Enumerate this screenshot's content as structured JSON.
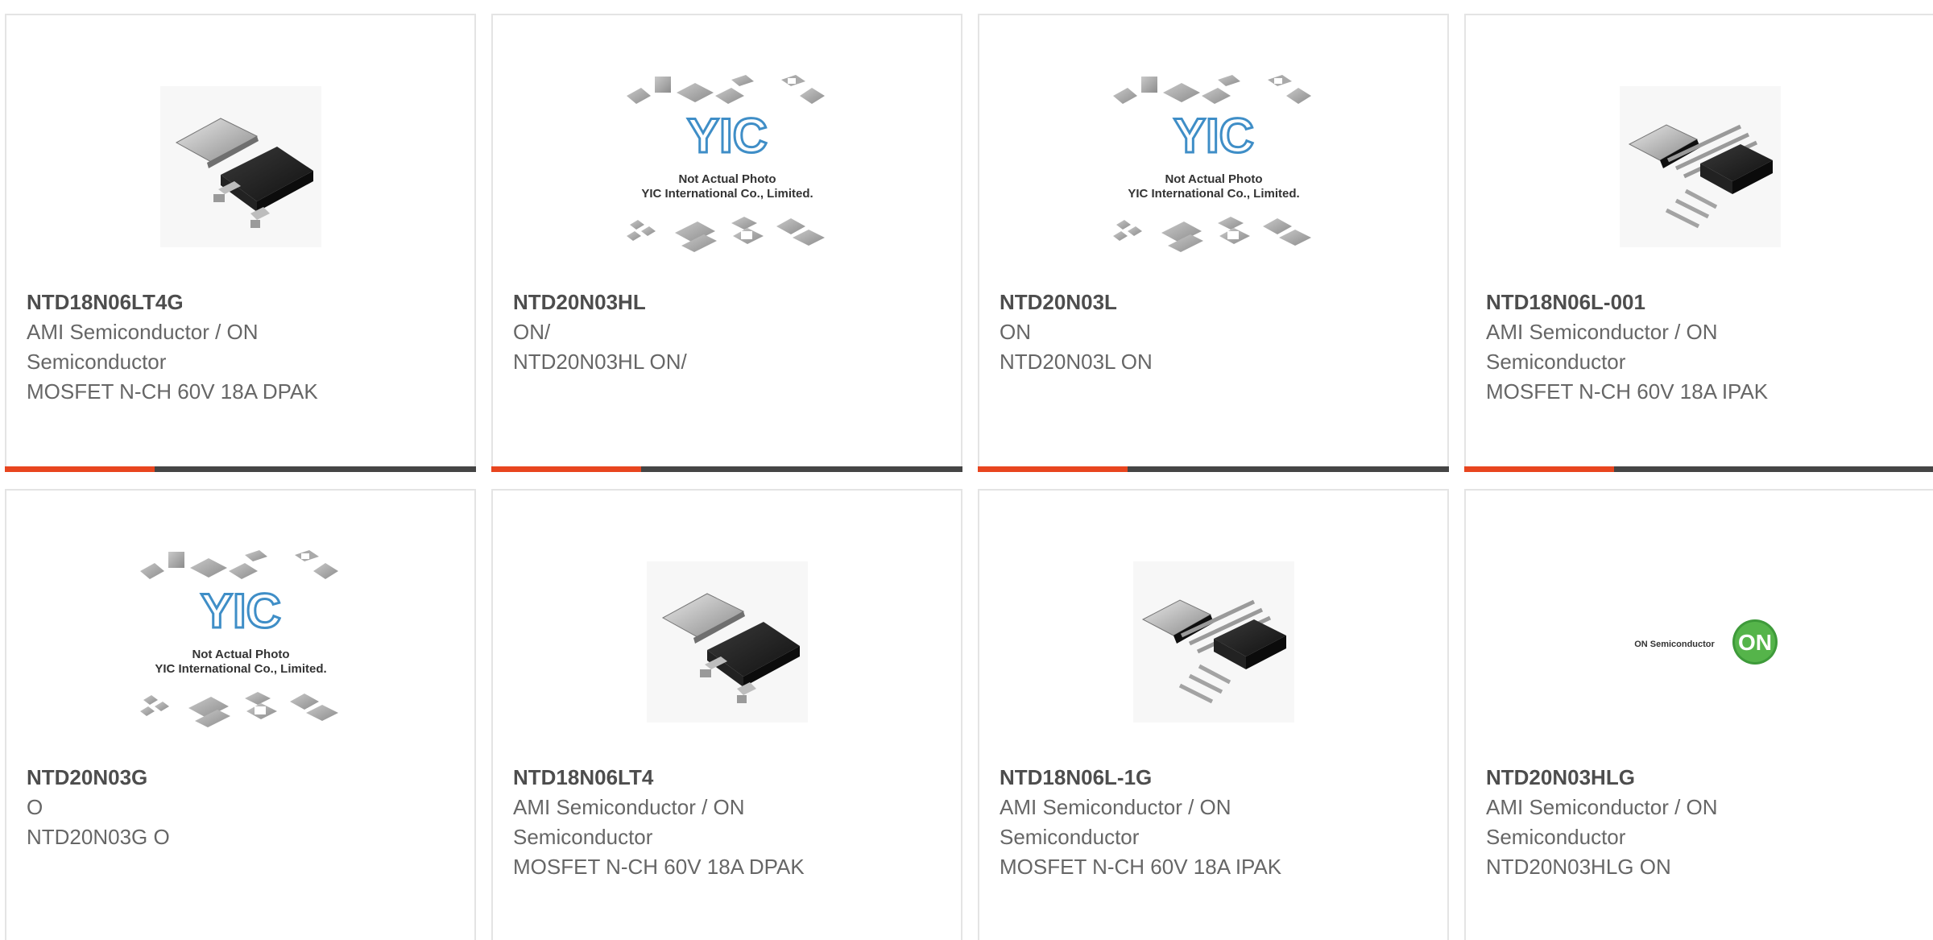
{
  "colors": {
    "accent": "#e8451f",
    "bar": "#454545",
    "title": "#4d4d4d",
    "text": "#666666",
    "border": "#e4e4e4"
  },
  "products": [
    {
      "part_number": "NTD18N06LT4G",
      "lines": [
        "AMI Semiconductor / ON",
        "Semiconductor",
        "MOSFET N-CH 60V 18A DPAK"
      ],
      "image": "dpak-package"
    },
    {
      "part_number": "NTD20N03HL",
      "lines": [
        "ON/",
        "NTD20N03HL ON/"
      ],
      "image": "yic-placeholder",
      "placeholder_text": [
        "Not Actual Photo",
        "YIC International Co., Limited."
      ],
      "placeholder_logo": "YIC"
    },
    {
      "part_number": "NTD20N03L",
      "lines": [
        "ON",
        "NTD20N03L ON"
      ],
      "image": "yic-placeholder",
      "placeholder_text": [
        "Not Actual Photo",
        "YIC International Co., Limited."
      ],
      "placeholder_logo": "YIC"
    },
    {
      "part_number": "NTD18N06L-001",
      "lines": [
        "AMI Semiconductor / ON",
        "Semiconductor",
        "MOSFET N-CH 60V 18A IPAK"
      ],
      "image": "ipak-package"
    },
    {
      "part_number": "NTD20N03G",
      "lines": [
        "O",
        "NTD20N03G O"
      ],
      "image": "yic-placeholder",
      "placeholder_text": [
        "Not Actual Photo",
        "YIC International Co., Limited."
      ],
      "placeholder_logo": "YIC"
    },
    {
      "part_number": "NTD18N06LT4",
      "lines": [
        "AMI Semiconductor / ON",
        "Semiconductor",
        "MOSFET N-CH 60V 18A DPAK"
      ],
      "image": "dpak-package"
    },
    {
      "part_number": "NTD18N06L-1G",
      "lines": [
        "AMI Semiconductor / ON",
        "Semiconductor",
        "MOSFET N-CH 60V 18A IPAK"
      ],
      "image": "ipak-package"
    },
    {
      "part_number": "NTD20N03HLG",
      "lines": [
        "AMI Semiconductor / ON",
        "Semiconductor",
        "NTD20N03HLG ON"
      ],
      "image": "on-semiconductor-logo",
      "logo_text": "ON Semiconductor",
      "logo_badge": "ON"
    }
  ]
}
